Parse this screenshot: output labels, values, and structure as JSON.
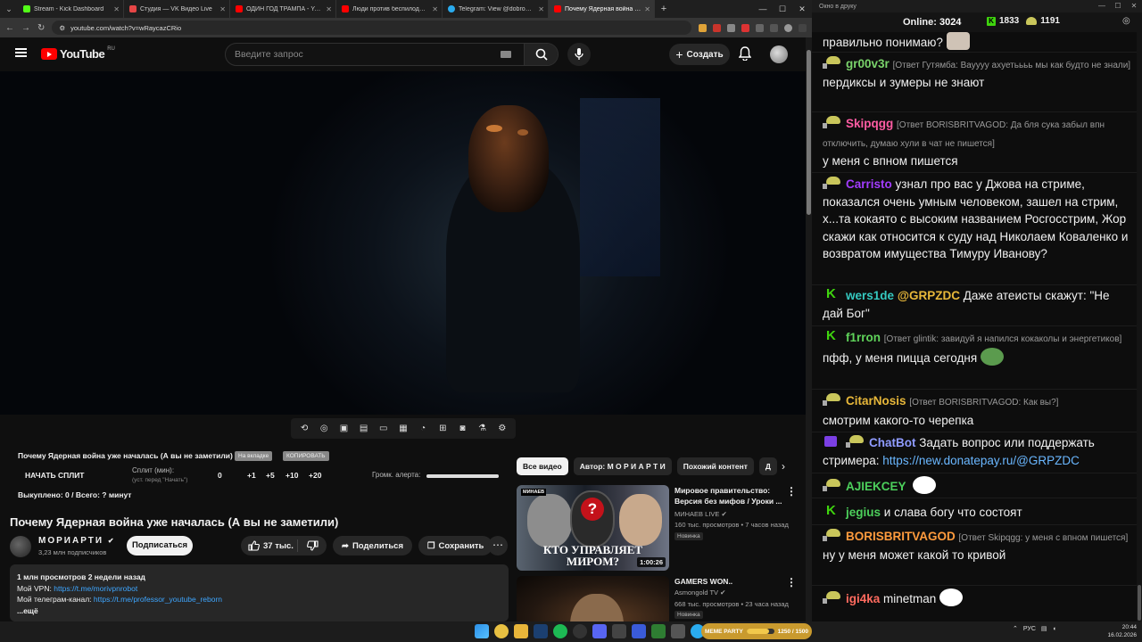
{
  "browser": {
    "tabs": [
      {
        "title": "Stream - Kick Dashboard",
        "color": "#53fc18"
      },
      {
        "title": "Студия — VK Видео Live",
        "color": "#e64646"
      },
      {
        "title": "ОДИН ГОД ТРАМПА - YouTube",
        "color": "#ff0000"
      },
      {
        "title": "Люди против беспилодия: сем...",
        "color": "#ff0000"
      },
      {
        "title": "Telegram: View @dobro_2ch",
        "color": "#2aabee"
      },
      {
        "title": "Почему Ядерная война уже...",
        "color": "#ff0000"
      }
    ],
    "url": "youtube.com/watch?v=wRaycazCRio",
    "new_tab": "+",
    "minimize": "—",
    "maximize": "☐",
    "close": "✕"
  },
  "youtube": {
    "logo_text": "YouTube",
    "region": "RU",
    "search_placeholder": "Введите запрос",
    "create_label": "Создать",
    "split": {
      "title": "Почему Ядерная война уже началась (А вы не заметили)",
      "pill1": "На вкладке",
      "pill2": "КОПИРОВАТЬ",
      "start": "НАЧАТЬ СПЛИТ",
      "minutes_label": "Сплит (мин):",
      "minutes_hint": "(уст. перед \"Начать\")",
      "value": "0",
      "adds": [
        "+1",
        "+5",
        "+10",
        "+20"
      ],
      "alert_label": "Громк. алерта:",
      "alert_level": 1.0,
      "status": "Выкуплено: 0 / Всего: ? минут"
    },
    "video_title": "Почему Ядерная война уже началась (А вы не заметили)",
    "channel": {
      "name": "МОРИАРТИ",
      "subs": "3,23 млн подписчиков"
    },
    "subscribe": "Подписаться",
    "likes": "37 тыс.",
    "share": "Поделиться",
    "save": "Сохранить",
    "description": {
      "line1": "1 млн просмотров  2 недели назад",
      "vpn_label": "Мой VPN: ",
      "vpn_link": "https://t.me/morivpnrobot",
      "tg_label": "Мой телеграм-канал: ",
      "tg_link": "https://t.me/professor_youtube_reborn",
      "more": "...ещё"
    },
    "chips": [
      "Все видео",
      "Автор: М О Р И А Р Т И",
      "Похожий контент",
      "Д"
    ],
    "recommendations": [
      {
        "title": "Мировое правительство: Версия без мифов / Уроки ...",
        "channel": "МИНАЕВ LIVE",
        "meta": "160 тыс. просмотров • 7 часов назад",
        "badge": "Новинка",
        "duration": "1:00:26",
        "brand": "МИНАЕВ",
        "thumb_caption": "КТО УПРАВЛЯЕТ МИРОМ?"
      },
      {
        "title": "GAMERS WON..",
        "channel": "Asmongold TV",
        "meta": "668 тыс. просмотров • 23 часа назад",
        "badge": "Новинка"
      }
    ]
  },
  "chat": {
    "window_title": "Окно в друку",
    "online_label": "Online:",
    "online": "3024",
    "kick_count": "1833",
    "ws_count": "1191",
    "messages": [
      {
        "text": "правильно понимаю?"
      },
      {
        "user": "gr00v3r",
        "color": "#7ad36b",
        "reply": "[Ответ Гутямба: Вауууу ахуетьььь мы как будто не знали]",
        "text": "пердиксы и зумеры не знают"
      },
      {
        "user": "Skipqgg",
        "color": "#ff5ca3",
        "reply": "[Ответ BORISBRITVAGOD: Да бля сука забыл впн отключить, думаю хули в чат не пишется]",
        "text": "у меня с впном пишется"
      },
      {
        "user": "Carristo",
        "color": "#a23cff",
        "text": "узнал про вас у Джова на стриме, показался очень умным человеком, зашел на стрим, х...та кокаято с высоким названием Росгосстрим, Жор скажи как относится к суду над Николаем Коваленко и возвратом имущества Тимуру Иванову?"
      },
      {
        "user": "wers1de",
        "color": "#35c9c0",
        "mention": "@GRPZDC",
        "text": "Даже атеисты скажут: \"Не дай Бог\""
      },
      {
        "user": "f1rron",
        "color": "#5fd35a",
        "reply": "[Ответ glintik: завидуй я напился кокаколы и энергетиков]",
        "text": "пфф, у меня пицца сегодня"
      },
      {
        "user": "CitarNosis",
        "color": "#e8b83a",
        "reply": "[Ответ BORISBRITVAGOD: Как вы?]",
        "text": "смотрим какого-то черепка"
      },
      {
        "user": "ChatBot",
        "color": "#8f9bff",
        "text": "Задать вопрос или поддержать стримера: ",
        "link": "https://new.donatepay.ru/@GRPZDC"
      },
      {
        "user": "AJIEKCEY",
        "color": "#4ccf5b",
        "text": ""
      },
      {
        "user": "jegius",
        "color": "#4ccf5b",
        "text": "и слава богу что состоят"
      },
      {
        "user": "BORISBRITVAGOD",
        "color": "#ff9b3d",
        "reply": "[Ответ Skipqgg: у меня с впном пишется]",
        "text": "ну у меня может какой то кривой"
      },
      {
        "user": "igi4ka",
        "color": "#ff6b5f",
        "text": "minetman"
      }
    ]
  },
  "taskbar": {
    "meme_label": "MEME PARTY",
    "meme_progress": "1250 / 1500",
    "meme_fraction": 0.83,
    "lang": "РУС",
    "time": "20:44",
    "date": "16.02.2026"
  }
}
